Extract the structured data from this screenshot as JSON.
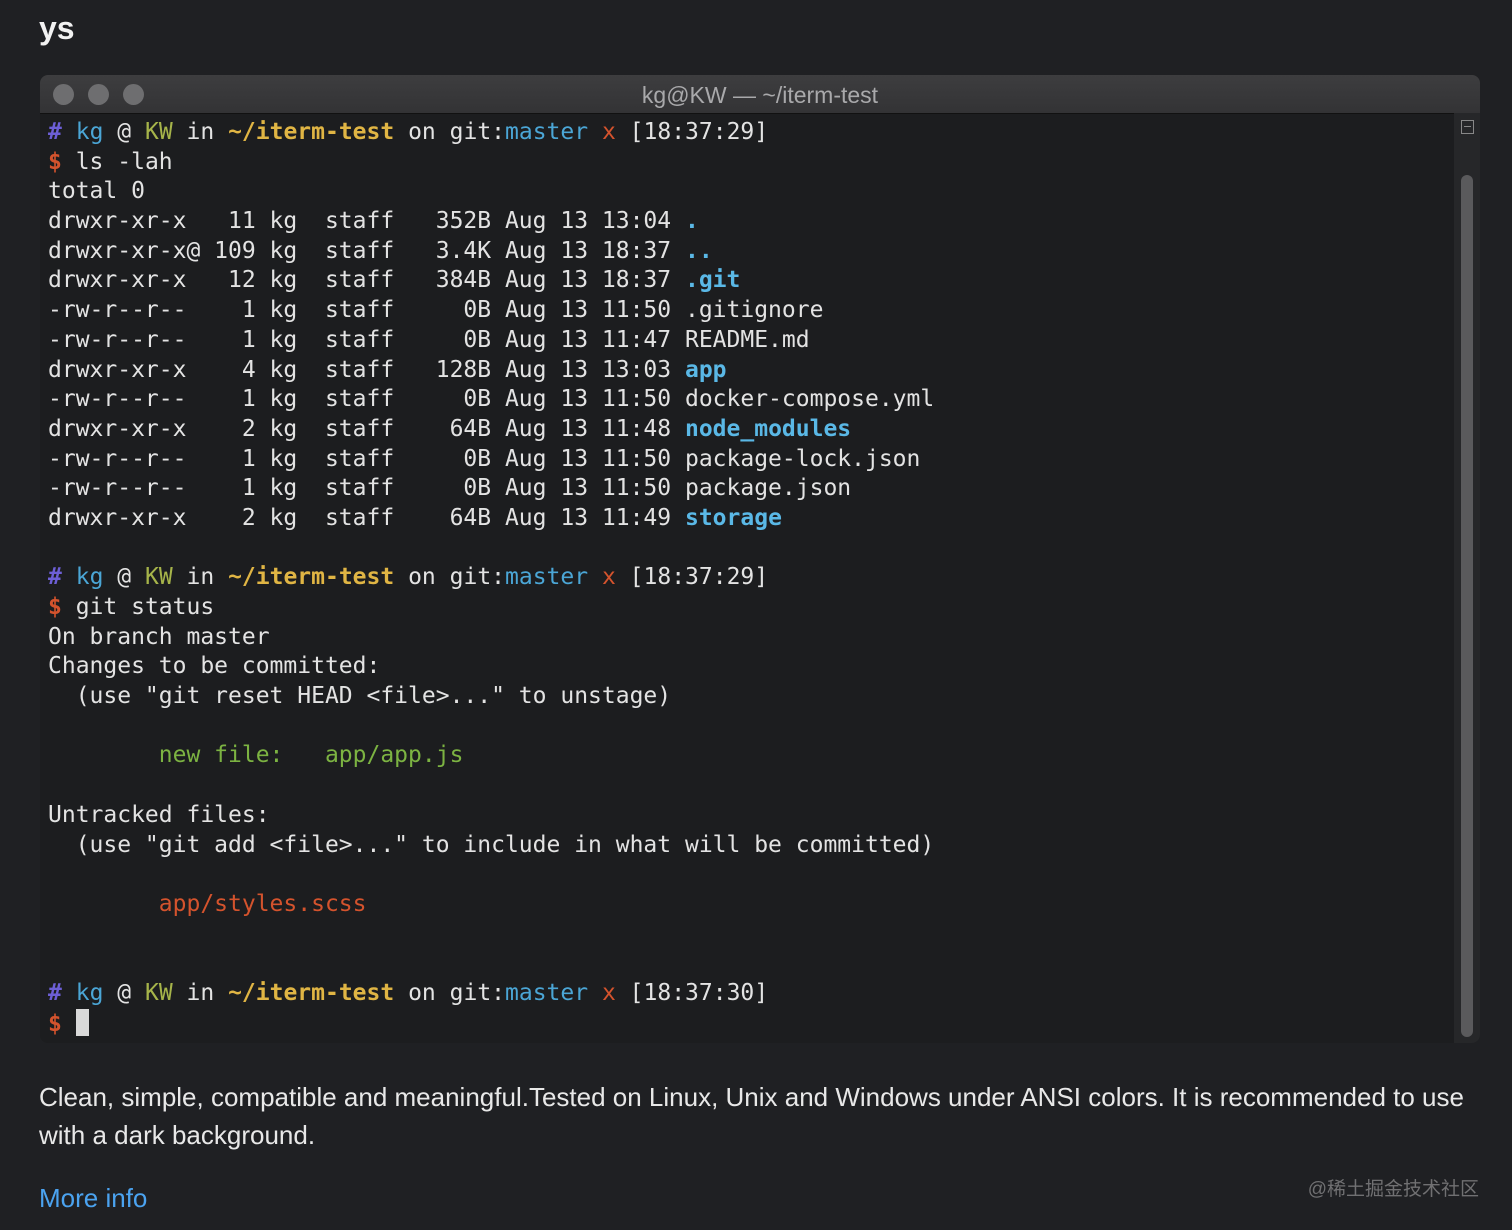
{
  "page_title": "ys",
  "window": {
    "title": "kg@KW — ~/iterm-test"
  },
  "prompt": {
    "hash": "#",
    "user": "kg",
    "at": "@",
    "host": "KW",
    "in": "in",
    "path": "~/iterm-test",
    "on": "on git:",
    "branch": "master",
    "dirty": "x",
    "dollar": "$"
  },
  "blocks": [
    {
      "time": "[18:37:29]",
      "command": "ls -lah",
      "output": [
        {
          "segments": [
            {
              "t": "total 0",
              "c": ""
            }
          ]
        },
        {
          "segments": [
            {
              "t": "drwxr-xr-x   11 kg  staff   352B Aug 13 13:04 ",
              "c": ""
            },
            {
              "t": ".",
              "c": "dir"
            }
          ]
        },
        {
          "segments": [
            {
              "t": "drwxr-xr-x@ 109 kg  staff   3.4K Aug 13 18:37 ",
              "c": ""
            },
            {
              "t": "..",
              "c": "dir"
            }
          ]
        },
        {
          "segments": [
            {
              "t": "drwxr-xr-x   12 kg  staff   384B Aug 13 18:37 ",
              "c": ""
            },
            {
              "t": ".git",
              "c": "dir"
            }
          ]
        },
        {
          "segments": [
            {
              "t": "-rw-r--r--    1 kg  staff     0B Aug 13 11:50 .gitignore",
              "c": ""
            }
          ]
        },
        {
          "segments": [
            {
              "t": "-rw-r--r--    1 kg  staff     0B Aug 13 11:47 README.md",
              "c": ""
            }
          ]
        },
        {
          "segments": [
            {
              "t": "drwxr-xr-x    4 kg  staff   128B Aug 13 13:03 ",
              "c": ""
            },
            {
              "t": "app",
              "c": "dir"
            }
          ]
        },
        {
          "segments": [
            {
              "t": "-rw-r--r--    1 kg  staff     0B Aug 13 11:50 docker-compose.yml",
              "c": ""
            }
          ]
        },
        {
          "segments": [
            {
              "t": "drwxr-xr-x    2 kg  staff    64B Aug 13 11:48 ",
              "c": ""
            },
            {
              "t": "node_modules",
              "c": "dir"
            }
          ]
        },
        {
          "segments": [
            {
              "t": "-rw-r--r--    1 kg  staff     0B Aug 13 11:50 package-lock.json",
              "c": ""
            }
          ]
        },
        {
          "segments": [
            {
              "t": "-rw-r--r--    1 kg  staff     0B Aug 13 11:50 package.json",
              "c": ""
            }
          ]
        },
        {
          "segments": [
            {
              "t": "drwxr-xr-x    2 kg  staff    64B Aug 13 11:49 ",
              "c": ""
            },
            {
              "t": "storage",
              "c": "dir"
            }
          ]
        },
        {
          "segments": [
            {
              "t": "",
              "c": ""
            }
          ]
        }
      ]
    },
    {
      "time": "[18:37:29]",
      "command": "git status",
      "output": [
        {
          "segments": [
            {
              "t": "On branch master",
              "c": ""
            }
          ]
        },
        {
          "segments": [
            {
              "t": "Changes to be committed:",
              "c": ""
            }
          ]
        },
        {
          "segments": [
            {
              "t": "  (use \"git reset HEAD <file>...\" to unstage)",
              "c": ""
            }
          ]
        },
        {
          "segments": [
            {
              "t": "",
              "c": ""
            }
          ]
        },
        {
          "segments": [
            {
              "t": "        new file:   app/app.js",
              "c": "green"
            }
          ]
        },
        {
          "segments": [
            {
              "t": "",
              "c": ""
            }
          ]
        },
        {
          "segments": [
            {
              "t": "Untracked files:",
              "c": ""
            }
          ]
        },
        {
          "segments": [
            {
              "t": "  (use \"git add <file>...\" to include in what will be committed)",
              "c": ""
            }
          ]
        },
        {
          "segments": [
            {
              "t": "",
              "c": ""
            }
          ]
        },
        {
          "segments": [
            {
              "t": "        app/styles.scss",
              "c": "red"
            }
          ]
        },
        {
          "segments": [
            {
              "t": "",
              "c": ""
            }
          ]
        },
        {
          "segments": [
            {
              "t": "",
              "c": ""
            }
          ]
        }
      ]
    },
    {
      "time": "[18:37:30]",
      "command": "",
      "output": []
    }
  ],
  "description": "Clean, simple, compatible and meaningful.Tested on Linux, Unix and Windows under ANSI colors. It is recommended to use with a dark background.",
  "more_info": "More info",
  "watermark": "@稀土掘金技术社区"
}
